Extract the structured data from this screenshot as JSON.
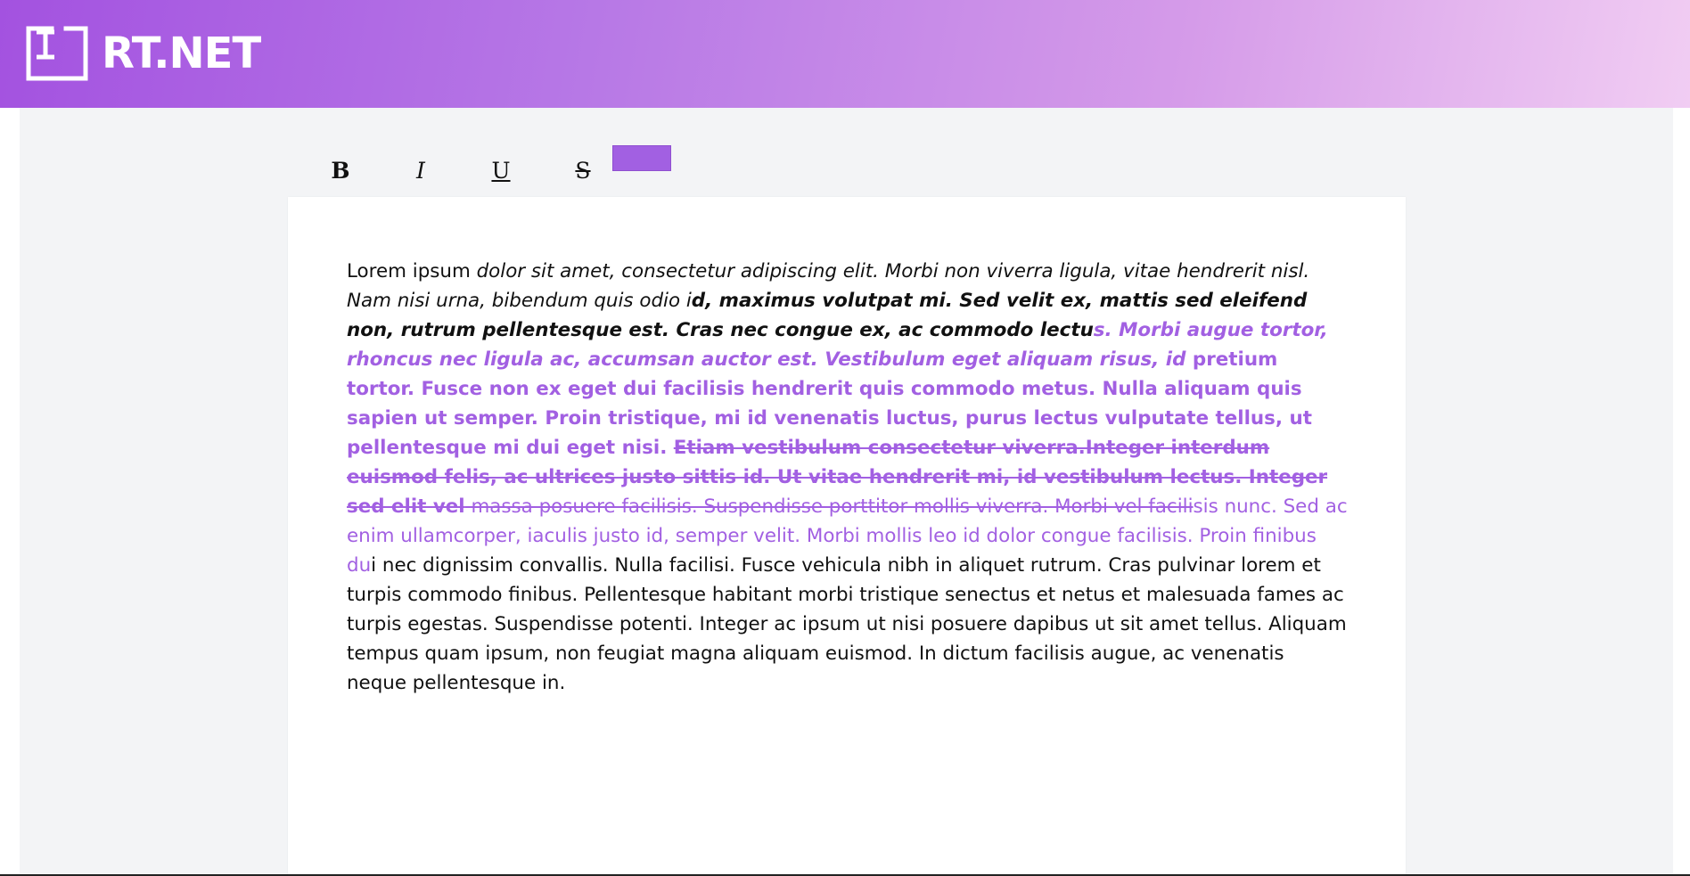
{
  "header": {
    "logo_text": "RT.NET",
    "logo_icon": "text-cursor-icon",
    "gradient_colors": [
      "#a352e0",
      "#f1cdf3"
    ]
  },
  "toolbar": {
    "bold_label": "B",
    "italic_label": "I",
    "underline_label": "U",
    "strike_label": "S",
    "text_color": "#a260e2"
  },
  "editor": {
    "segments": [
      "Lorem ipsum ",
      "dolor sit amet, consectetur adipiscing elit. Morbi non viverra ligula, vitae hendrerit nisl. Nam nisi urna, bibendum quis odio i",
      "d, maximus volutpat mi. Sed velit ex, mattis sed eleifend non, rutrum pellentesque est. Cras nec congue ex, ac commodo lectu",
      "s. Morbi augue tortor, rhoncus nec ligula ac, accumsan auctor est. Vestibulum eget aliquam risus, id",
      " pretium tortor. Fusce non ex eget dui facilisis hendrerit quis commodo metus. Nulla aliquam quis sapien ut semper. Proin tristique, mi id venenatis luctus, purus lectus vulputate tellus, ut pellentesque mi dui eget nisi. ",
      "Etiam vestibulum consectetur viverra.Integer interdum euismod felis, ac ultrices justo sittis id. Ut vitae hendrerit mi, id vestibulum lectus. Integer sed elit vel",
      " massa posuere facilisis. Suspendisse porttitor mollis viverra. Morbi vel facili",
      "sis nunc. Sed ac enim ullamcorper, iaculis justo id, semper velit. Morbi mollis leo id dolor congue facilisis. Proin finibus du",
      "i nec dignissim convallis. Nulla facilisi. Fusce vehicula nibh in aliquet rutrum. Cras pulvinar lorem et turpis commodo finibus. Pellentesque habitant morbi tristique senectus et netus et malesuada fames ac turpis egestas. Suspendisse potenti. Integer ac ipsum ut nisi posuere dapibus ut sit amet tellus. Aliquam tempus quam ipsum, non feugiat magna aliquam euismod. In dictum facilisis augue, ac venenatis neque pellentesque in."
    ]
  }
}
